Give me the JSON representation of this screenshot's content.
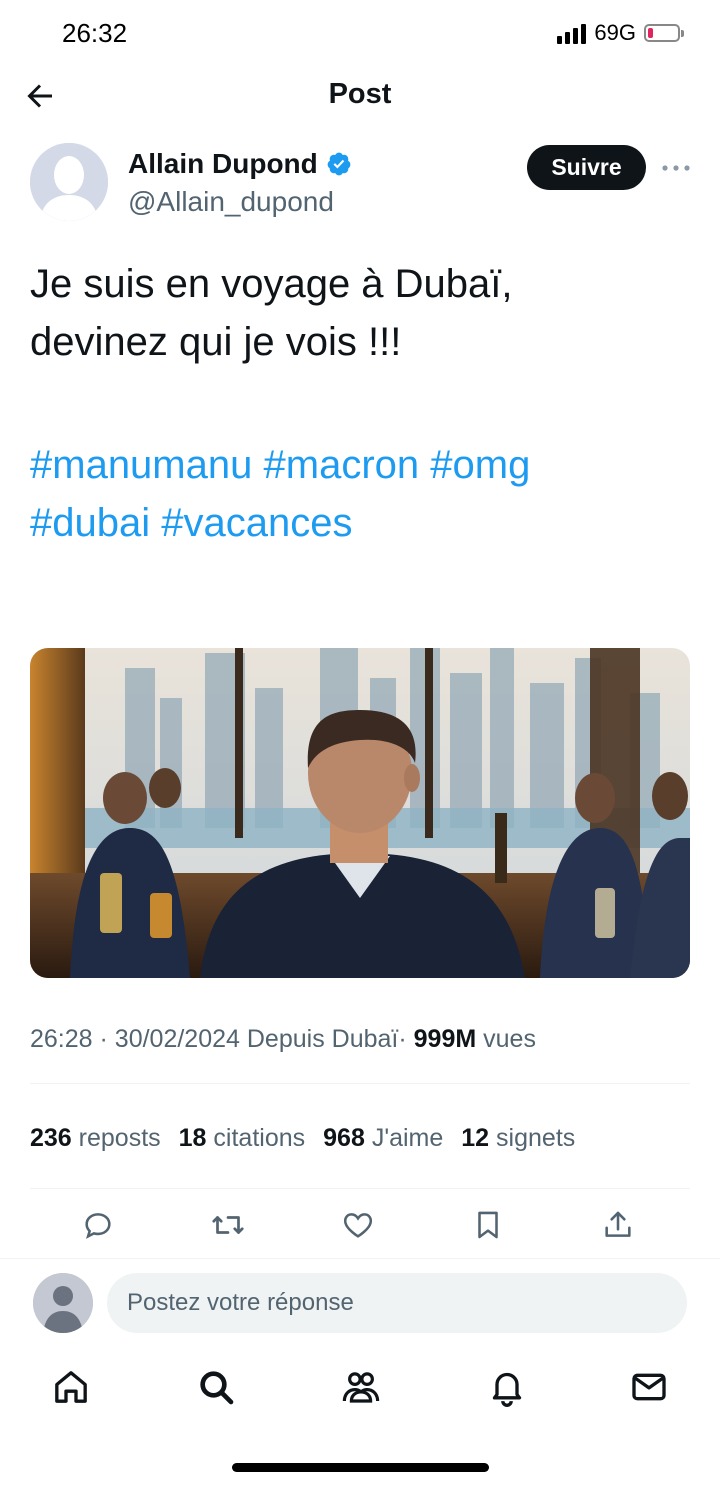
{
  "status_bar": {
    "time": "26:32",
    "network": "69G"
  },
  "header": {
    "title": "Post"
  },
  "author": {
    "name": "Allain Dupond",
    "handle": "@Allain_dupond",
    "verified": true,
    "follow_label": "Suivre"
  },
  "post": {
    "text_line1": "Je suis en voyage à Dubaï,",
    "text_line2": "devinez qui je vois !!!",
    "hashtags_line1": [
      "#manumanu",
      "#macron",
      "#omg"
    ],
    "hashtags_line2": [
      "#dubai",
      "#vacances"
    ],
    "hashtag_color": "#1d9bf0"
  },
  "meta": {
    "time": "26:28",
    "sep": "·",
    "date": "30/02/2024",
    "location": "Depuis Dubaï",
    "views_count": "999M",
    "views_label": "vues"
  },
  "stats": [
    {
      "count": "236",
      "label": "reposts"
    },
    {
      "count": "18",
      "label": "citations"
    },
    {
      "count": "968",
      "label": "J'aime"
    },
    {
      "count": "12",
      "label": "signets"
    }
  ],
  "actions": [
    "reply-icon",
    "repost-icon",
    "like-icon",
    "bookmark-icon",
    "share-icon"
  ],
  "reply": {
    "placeholder": "Postez votre réponse"
  },
  "nav": [
    "home-icon",
    "search-icon",
    "communities-icon",
    "notifications-icon",
    "messages-icon"
  ],
  "colors": {
    "text": "#0f1419",
    "secondary": "#536471",
    "link": "#1d9bf0",
    "verified": "#1d9bf0"
  }
}
